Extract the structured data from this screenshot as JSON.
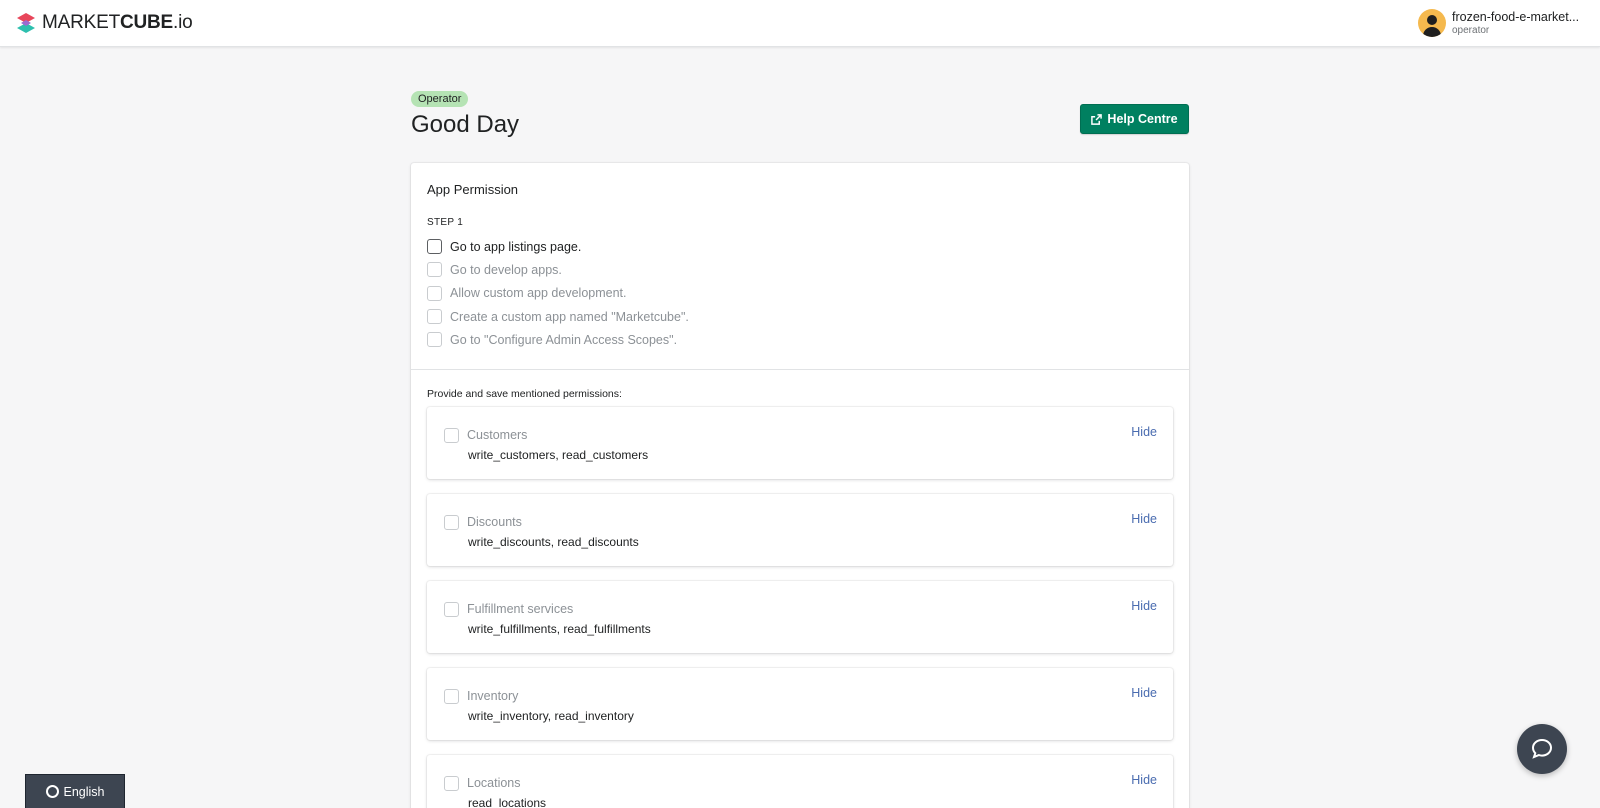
{
  "header": {
    "logo": {
      "text_regular_1": "MARKET",
      "text_bold": "CUBE",
      "text_regular_2": ".io",
      "icon": "marketcube-logo"
    },
    "user": {
      "name": "frozen-food-e-market...",
      "role": "operator",
      "avatar_icon": "user-avatar-icon"
    }
  },
  "page": {
    "badge": "Operator",
    "title": "Good Day",
    "help_button": {
      "label": "Help Centre",
      "icon": "external-link-icon"
    }
  },
  "card": {
    "title": "App Permission",
    "step_label": "STEP 1",
    "steps": [
      {
        "label": "Go to app listings page.",
        "active": true
      },
      {
        "label": "Go to develop apps.",
        "active": false
      },
      {
        "label": "Allow custom app development.",
        "active": false
      },
      {
        "label": "Create a custom app named \"Marketcube\".",
        "active": false
      },
      {
        "label": "Go to \"Configure Admin Access Scopes\".",
        "active": false
      }
    ],
    "permissions_intro": "Provide and save mentioned permissions:",
    "permissions": [
      {
        "name": "Customers",
        "scopes": "write_customers, read_customers",
        "action": "Hide"
      },
      {
        "name": "Discounts",
        "scopes": "write_discounts, read_discounts",
        "action": "Hide"
      },
      {
        "name": "Fulfillment services",
        "scopes": "write_fulfillments, read_fulfillments",
        "action": "Hide"
      },
      {
        "name": "Inventory",
        "scopes": "write_inventory, read_inventory",
        "action": "Hide"
      },
      {
        "name": "Locations",
        "scopes": "read_locations",
        "action": "Hide"
      }
    ]
  },
  "footer": {
    "language_button": {
      "label": "English",
      "icon": "globe-ring-icon"
    },
    "chat_button": {
      "icon": "chat-bubble-icon"
    }
  },
  "colors": {
    "primary": "#008060",
    "badge_bg": "#b5e3b4",
    "link": "#4a6cb0",
    "dark": "#3d4551",
    "logo_red": "#e8465a",
    "logo_teal": "#2dbfae"
  }
}
